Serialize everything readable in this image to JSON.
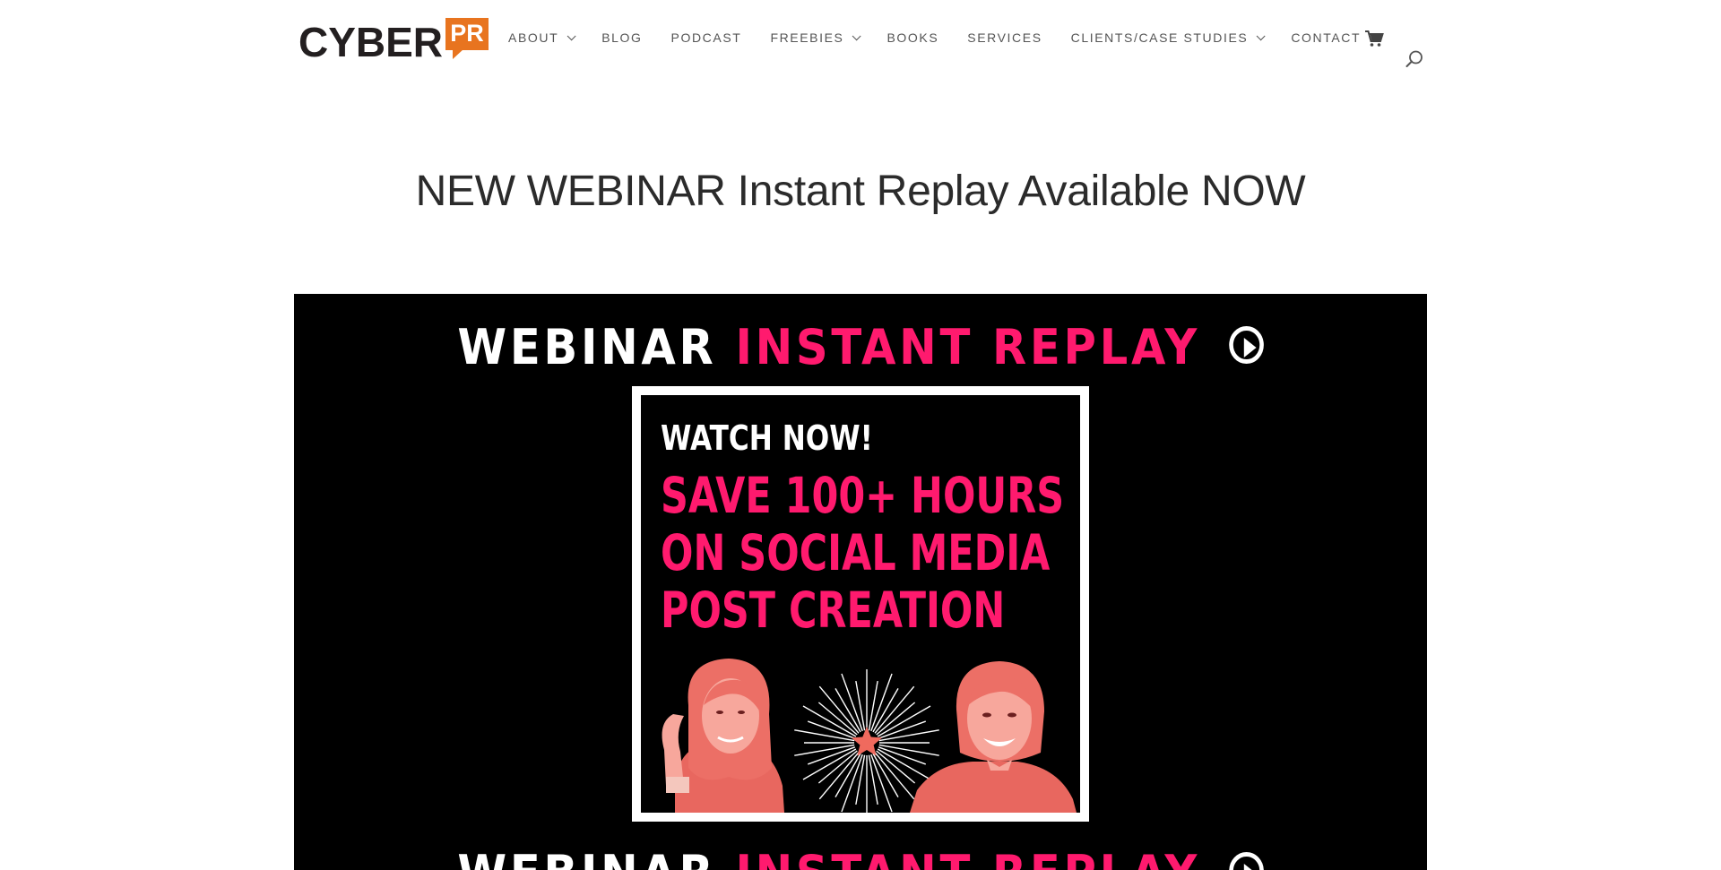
{
  "header": {
    "logo": {
      "word": "CYBER",
      "badge": "PR"
    },
    "nav": [
      {
        "label": "ABOUT",
        "dropdown": true
      },
      {
        "label": "BLOG",
        "dropdown": false
      },
      {
        "label": "PODCAST",
        "dropdown": false
      },
      {
        "label": "FREEBIES",
        "dropdown": true
      },
      {
        "label": "BOOKS",
        "dropdown": false
      },
      {
        "label": "SERVICES",
        "dropdown": false
      },
      {
        "label": "CLIENTS/CASE STUDIES",
        "dropdown": true
      },
      {
        "label": "CONTACT",
        "dropdown": false
      }
    ],
    "icons": {
      "cart": "cart-icon",
      "search": "search-icon"
    }
  },
  "page_title": "NEW WEBINAR Instant Replay Available NOW",
  "hero": {
    "banner_white": "WEBINAR",
    "banner_pink": "INSTANT REPLAY",
    "poster": {
      "watch": "WATCH NOW!",
      "headline": [
        "SAVE 100+ HOURS",
        "ON SOCIAL MEDIA",
        "POST CREATION"
      ]
    }
  },
  "colors": {
    "accent_pink": "#ff1a6e",
    "logo_orange": "#e8741f",
    "hero_bg": "#000000"
  }
}
